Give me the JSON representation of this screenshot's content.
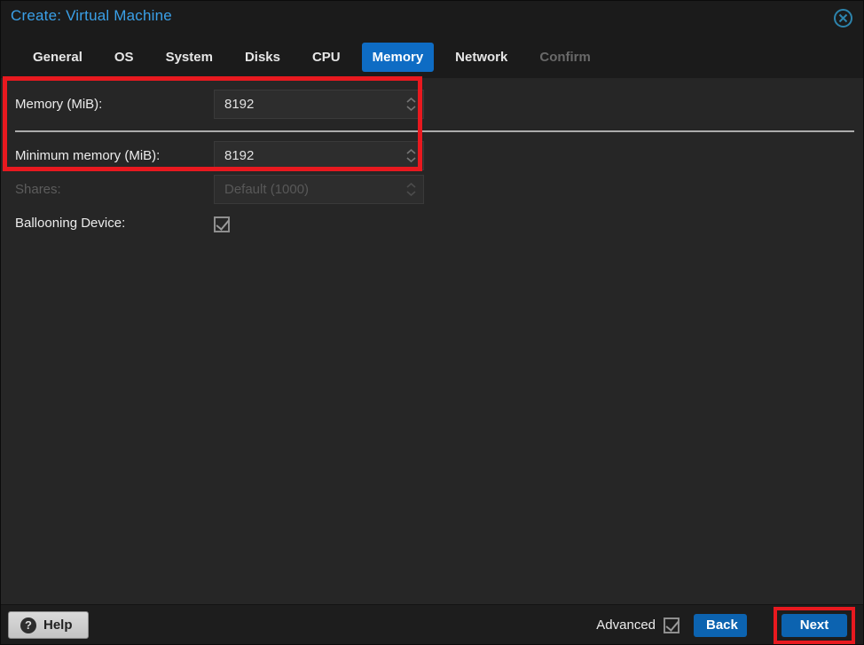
{
  "window": {
    "title": "Create: Virtual Machine"
  },
  "tabs": [
    {
      "label": "General",
      "state": "normal"
    },
    {
      "label": "OS",
      "state": "normal"
    },
    {
      "label": "System",
      "state": "normal"
    },
    {
      "label": "Disks",
      "state": "normal"
    },
    {
      "label": "CPU",
      "state": "normal"
    },
    {
      "label": "Memory",
      "state": "active"
    },
    {
      "label": "Network",
      "state": "normal"
    },
    {
      "label": "Confirm",
      "state": "disabled"
    }
  ],
  "form": {
    "memory": {
      "label": "Memory (MiB):",
      "value": "8192"
    },
    "min_memory": {
      "label": "Minimum memory (MiB):",
      "value": "8192"
    },
    "shares": {
      "label": "Shares:",
      "placeholder": "Default (1000)",
      "disabled": true
    },
    "ballooning": {
      "label": "Ballooning Device:",
      "checked": true
    }
  },
  "footer": {
    "help": "Help",
    "help_icon_glyph": "?",
    "advanced": "Advanced",
    "advanced_checked": true,
    "back": "Back",
    "next": "Next"
  },
  "colors": {
    "accent_blue": "#0e6cc4",
    "button_blue": "#0c63b0",
    "title_blue": "#3aa0e8",
    "close_icon_teal": "#2d84ad",
    "highlight_red": "#e8191f",
    "header_bg": "#1b1b1b",
    "content_bg": "#262626",
    "field_bg": "#2d2d2d"
  }
}
